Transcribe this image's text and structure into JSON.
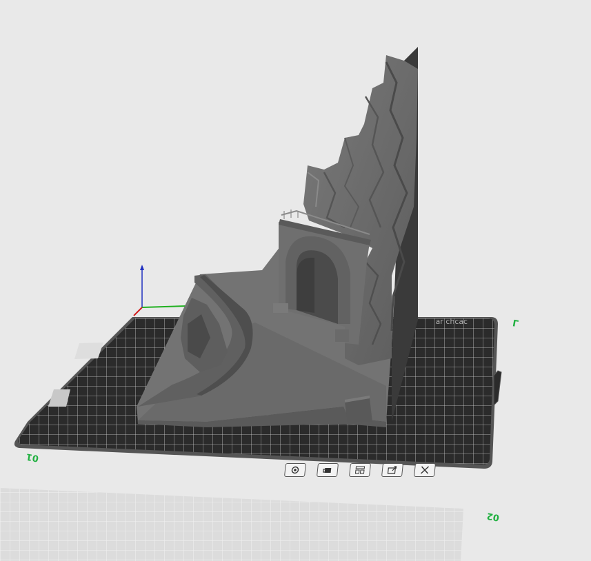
{
  "viewport": {
    "background_color": "#e9e9e9",
    "active_plate": {
      "index_label": "01",
      "plate_color": "#2b2b2b",
      "grid_color": "#cfcfcf",
      "plate_name_label": "ɔɐɔɥɔ ɹɐ"
    },
    "next_plate": {
      "index_label": "02"
    },
    "model": {
      "color": "#6e6e6e",
      "name": "tunnel-portal-diorama"
    },
    "axes": {
      "x_color": "#d22020",
      "y_color": "#20b020",
      "z_color": "#2030c0"
    },
    "plate_toolbar": {
      "buttons": [
        {
          "name": "settings",
          "icon": "gear-icon"
        },
        {
          "name": "lock",
          "icon": "lock-icon"
        },
        {
          "name": "arrange",
          "icon": "arrange-icon"
        },
        {
          "name": "auto-orient",
          "icon": "orient-icon"
        },
        {
          "name": "delete",
          "icon": "close-icon"
        }
      ]
    }
  }
}
